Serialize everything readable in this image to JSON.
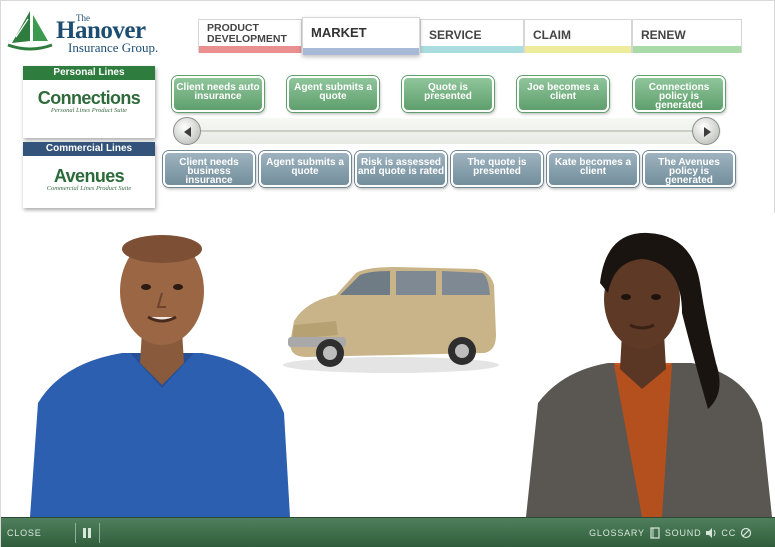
{
  "logo": {
    "the": "The",
    "name": "Hanover",
    "group": "Insurance Group."
  },
  "tabs": [
    {
      "label": "PRODUCT DEVELOPMENT",
      "bar_color": "#e98f8f"
    },
    {
      "label": "MARKET",
      "bar_color": "#a7b9d6"
    },
    {
      "label": "SERVICE",
      "bar_color": "#a9dde0"
    },
    {
      "label": "CLAIM",
      "bar_color": "#ecec9a"
    },
    {
      "label": "RENEW",
      "bar_color": "#a9dba9"
    }
  ],
  "products": {
    "personal": {
      "header": "Personal Lines",
      "brand": "Connections",
      "tagline": "Personal Lines Product Suite"
    },
    "commercial": {
      "header": "Commercial Lines",
      "brand": "Avenues",
      "tagline": "Commercial Lines Product Suite"
    }
  },
  "personal_steps": [
    "Client needs auto insurance",
    "Agent submits a quote",
    "Quote is presented",
    "Joe becomes a client",
    "Connections policy is generated"
  ],
  "commercial_steps": [
    "Client needs business insurance",
    "Agent submits a quote",
    "Risk is assessed and quote is rated",
    "The quote is presented",
    "Kate becomes a client",
    "The Avenues policy is generated"
  ],
  "bottom_bar": {
    "close": "CLOSE",
    "glossary": "GLOSSARY",
    "sound": "SOUND",
    "cc": "CC"
  },
  "colors": {
    "personal_green": "#2f7d3e",
    "commercial_blue": "#33537a",
    "step_green": "#6aa877",
    "step_blue": "#7d96a3",
    "footer_green": "#3f6f4b"
  }
}
